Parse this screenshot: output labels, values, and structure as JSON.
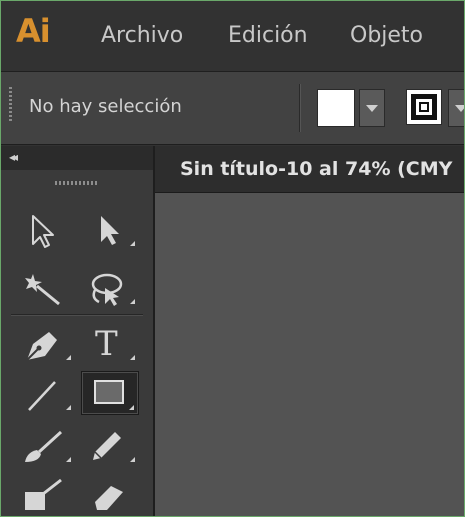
{
  "app": {
    "logo_text": "Ai",
    "logo_color": "#d8902e"
  },
  "menu": {
    "items": [
      "Archivo",
      "Edición",
      "Objeto"
    ]
  },
  "control_bar": {
    "selection_label": "No hay selección",
    "fill_color": "#ffffff"
  },
  "tools_panel": {
    "collapse_glyph": "◂◂",
    "tools": [
      {
        "name": "selection-tool",
        "icon": "selection-arrow-icon"
      },
      {
        "name": "direct-selection-tool",
        "icon": "direct-selection-arrow-icon"
      },
      {
        "name": "magic-wand-tool",
        "icon": "magic-wand-icon"
      },
      {
        "name": "lasso-tool",
        "icon": "lasso-icon"
      },
      {
        "name": "pen-tool",
        "icon": "pen-nib-icon"
      },
      {
        "name": "type-tool",
        "icon": "type-t-icon",
        "glyph": "T"
      },
      {
        "name": "line-segment-tool",
        "icon": "line-segment-icon"
      },
      {
        "name": "rectangle-tool",
        "icon": "rectangle-icon",
        "active": true
      },
      {
        "name": "paintbrush-tool",
        "icon": "paintbrush-icon"
      },
      {
        "name": "pencil-tool",
        "icon": "pencil-icon"
      },
      {
        "name": "blob-brush-tool",
        "icon": "blob-brush-icon"
      },
      {
        "name": "eraser-tool",
        "icon": "eraser-icon"
      }
    ]
  },
  "document": {
    "tab_title": "Sin título-10 al 74% (CMY"
  }
}
